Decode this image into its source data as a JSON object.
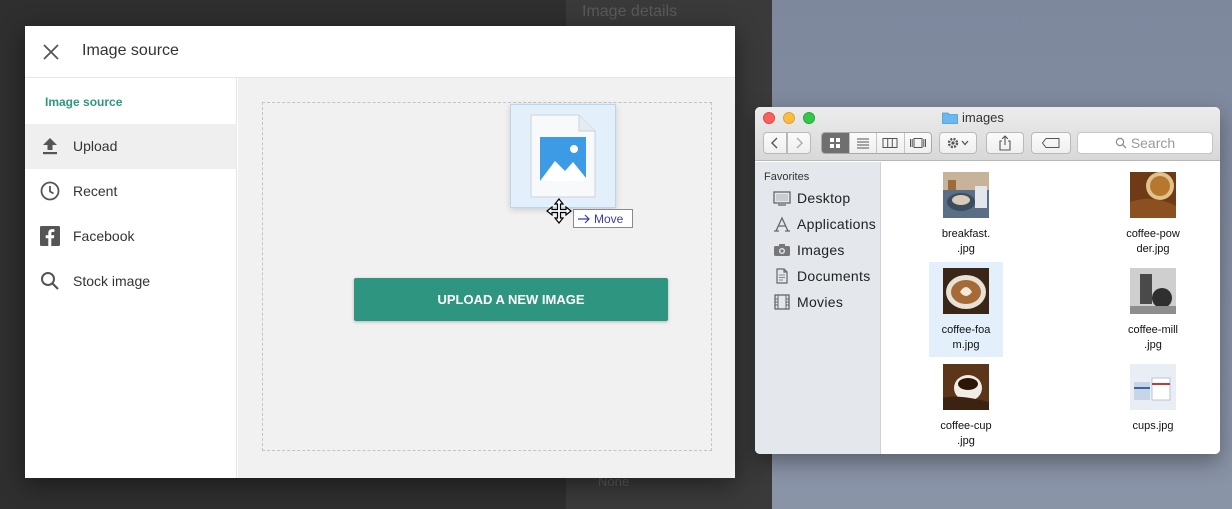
{
  "background": {
    "panel_title": "Image details",
    "panel_bottom_text": "None"
  },
  "dialog": {
    "title": "Image source",
    "close_icon": "close-icon",
    "sidebar": {
      "heading": "Image source",
      "items": [
        {
          "label": "Upload",
          "icon": "upload-icon",
          "active": true
        },
        {
          "label": "Recent",
          "icon": "clock-icon",
          "active": false
        },
        {
          "label": "Facebook",
          "icon": "facebook-icon",
          "active": false
        },
        {
          "label": "Stock image",
          "icon": "search-icon",
          "active": false
        }
      ]
    },
    "upload_button_label": "UPLOAD A NEW IMAGE"
  },
  "drag": {
    "tooltip_label": "Move"
  },
  "finder": {
    "title": "images",
    "search_placeholder": "Search",
    "favorites_heading": "Favorites",
    "favorites": [
      {
        "label": "Desktop",
        "icon": "desktop-icon"
      },
      {
        "label": "Applications",
        "icon": "applications-icon"
      },
      {
        "label": "Images",
        "icon": "camera-icon"
      },
      {
        "label": "Documents",
        "icon": "document-icon"
      },
      {
        "label": "Movies",
        "icon": "film-icon"
      }
    ],
    "files": [
      {
        "name": "breakfast.\n.jpg",
        "selected": false
      },
      {
        "name": "coffee-pow\nder.jpg",
        "selected": false
      },
      {
        "name": "coffee-foa\nm.jpg",
        "selected": true
      },
      {
        "name": "coffee-mill\n.jpg",
        "selected": false
      },
      {
        "name": "coffee-cup\n.jpg",
        "selected": false
      },
      {
        "name": "cups.jpg",
        "selected": false
      }
    ]
  },
  "colors": {
    "accent": "#2e9680",
    "selection": "#e3f0fb"
  }
}
